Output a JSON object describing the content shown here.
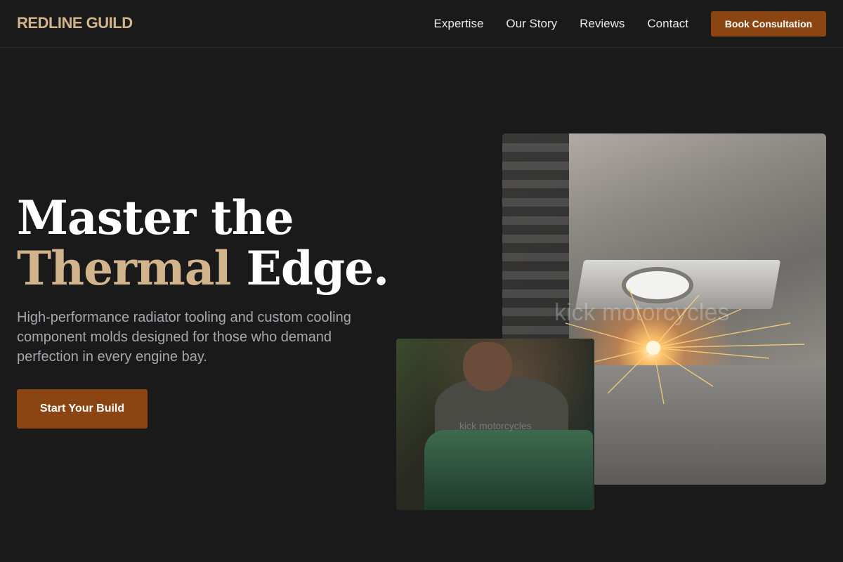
{
  "brand": {
    "logo": "REDLINE GUILD"
  },
  "nav": {
    "items": [
      "Expertise",
      "Our Story",
      "Reviews",
      "Contact"
    ],
    "cta": "Book Consultation"
  },
  "hero": {
    "title_line1": "Master the",
    "title_accent": "Thermal",
    "title_rest": "Edge.",
    "subtitle": "High-performance radiator tooling and custom cooling component molds designed for those who demand perfection in every engine bay.",
    "cta": "Start Your Build"
  },
  "images": {
    "watermark_large": "kick motorcycles",
    "watermark_small": "kick motorcycles"
  },
  "colors": {
    "background": "#1a1a1a",
    "accent": "#d2b48c",
    "button": "#8b4513",
    "subtitle_text": "#a6a8ad"
  }
}
